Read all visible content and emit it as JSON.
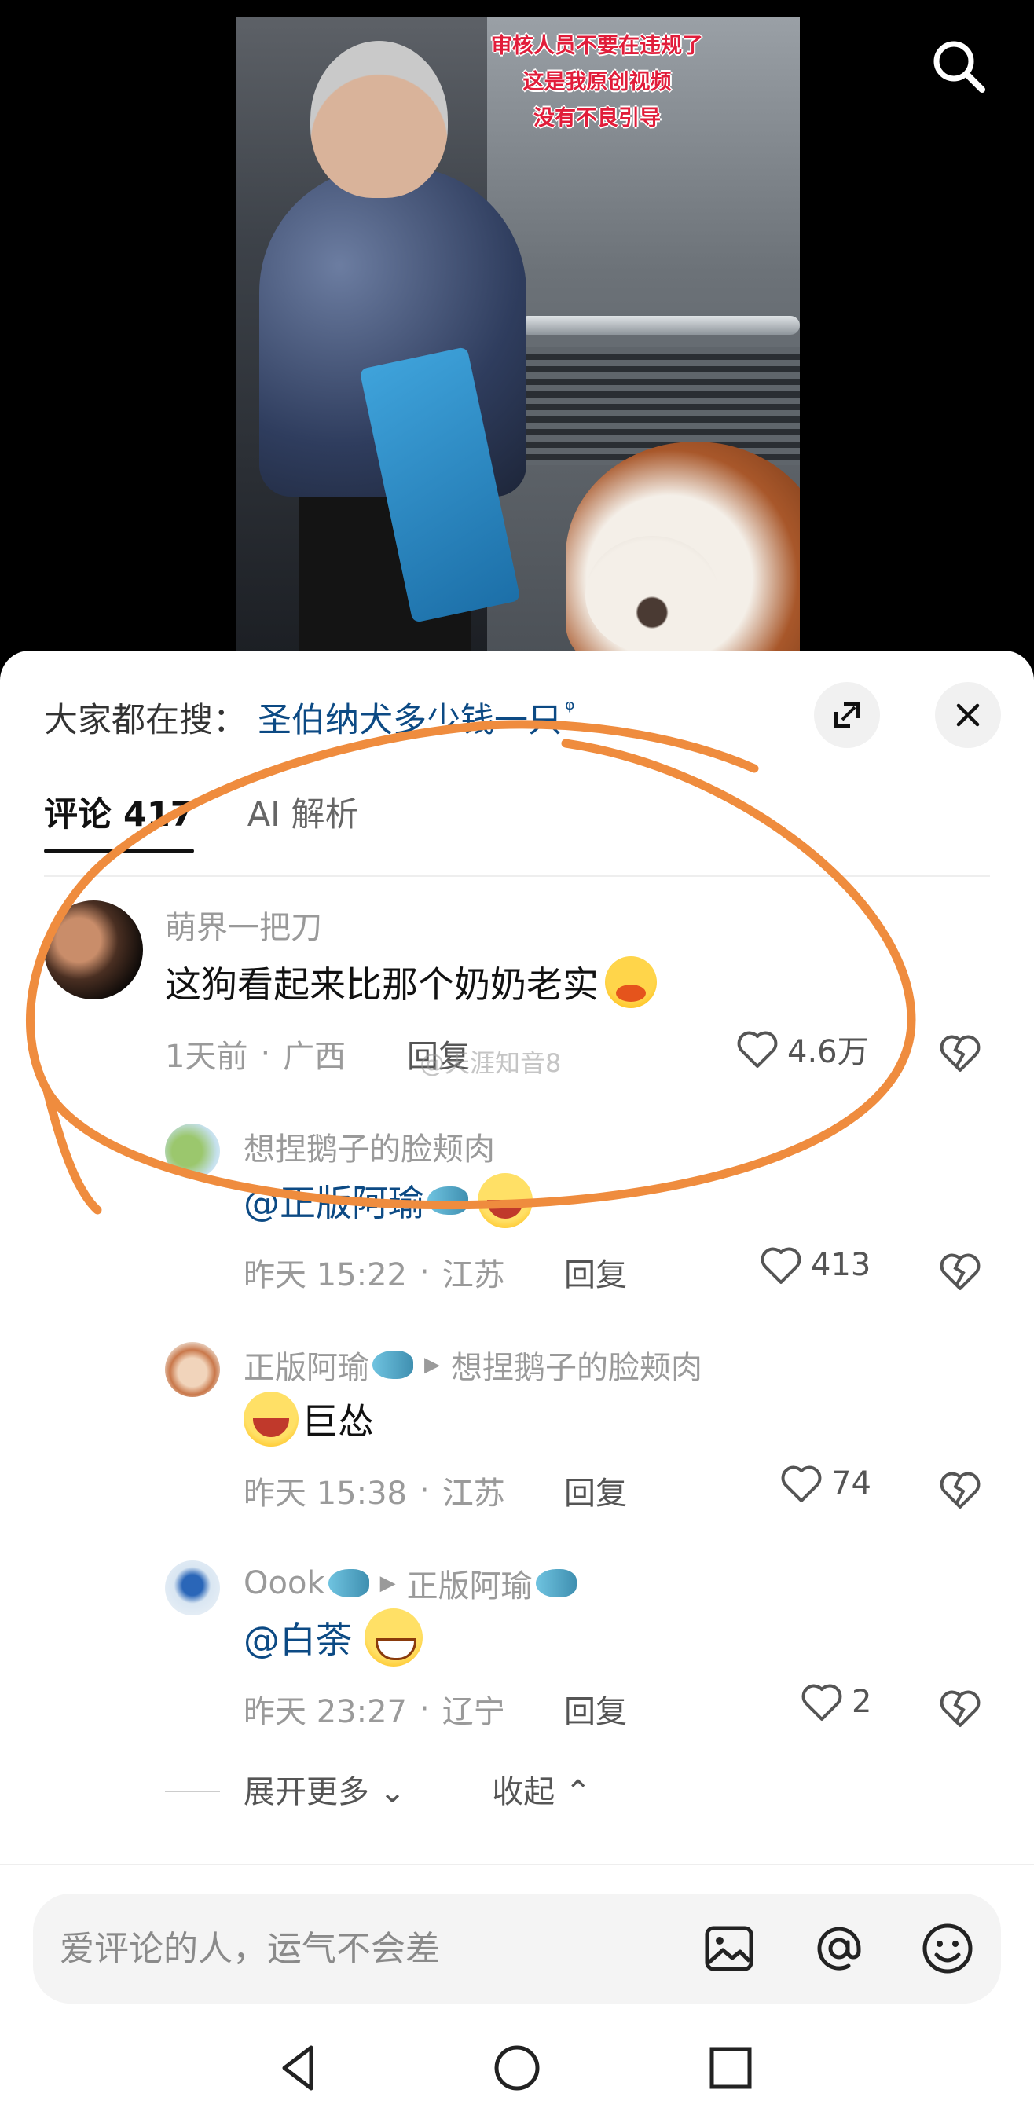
{
  "video": {
    "overlay_lines": [
      "审核人员不要在违规了",
      "这是我原创视频",
      "没有不良引导"
    ],
    "search_icon": "search-icon"
  },
  "sheet": {
    "trending_label": "大家都在搜：",
    "trending_term": "圣伯纳犬多少钱一只",
    "trending_icon_glyph": "ᵠ",
    "tabs": [
      {
        "label": "评论 417",
        "active": true
      },
      {
        "label": "AI 解析",
        "active": false
      }
    ],
    "watermark": "@天涯知音8",
    "comments": [
      {
        "username": "萌界一把刀",
        "text": "这狗看起来比那个奶奶老实",
        "time": "1天前",
        "location": "广西",
        "reply": "回复",
        "likes": "4.6万"
      }
    ],
    "replies": [
      {
        "username": "想捏鹅子的脸颊肉",
        "target": "",
        "mention": "@正版阿瑜",
        "text": "",
        "time": "昨天 15:22",
        "location": "江苏",
        "reply": "回复",
        "likes": "413"
      },
      {
        "username": "正版阿瑜",
        "target": "想捏鹅子的脸颊肉",
        "mention": "",
        "text": "巨怂",
        "time": "昨天 15:38",
        "location": "江苏",
        "reply": "回复",
        "likes": "74"
      },
      {
        "username": "Oook",
        "target": "正版阿瑜",
        "mention": "@白荼",
        "text": "",
        "time": "昨天 23:27",
        "location": "辽宁",
        "reply": "回复",
        "likes": "2"
      }
    ],
    "expand_more": "展开更多",
    "collapse": "收起",
    "separator": "·"
  },
  "composer": {
    "placeholder": "爱评论的人，运气不会差",
    "icons": [
      "image-icon",
      "at-icon",
      "emoji-icon"
    ]
  },
  "navbar": {
    "icons": [
      "back-icon",
      "home-icon",
      "recents-icon"
    ]
  },
  "colors": {
    "link": "#0c4a84",
    "annotation_orange": "#ef8c3e",
    "overlay_red": "#e11d3a"
  }
}
